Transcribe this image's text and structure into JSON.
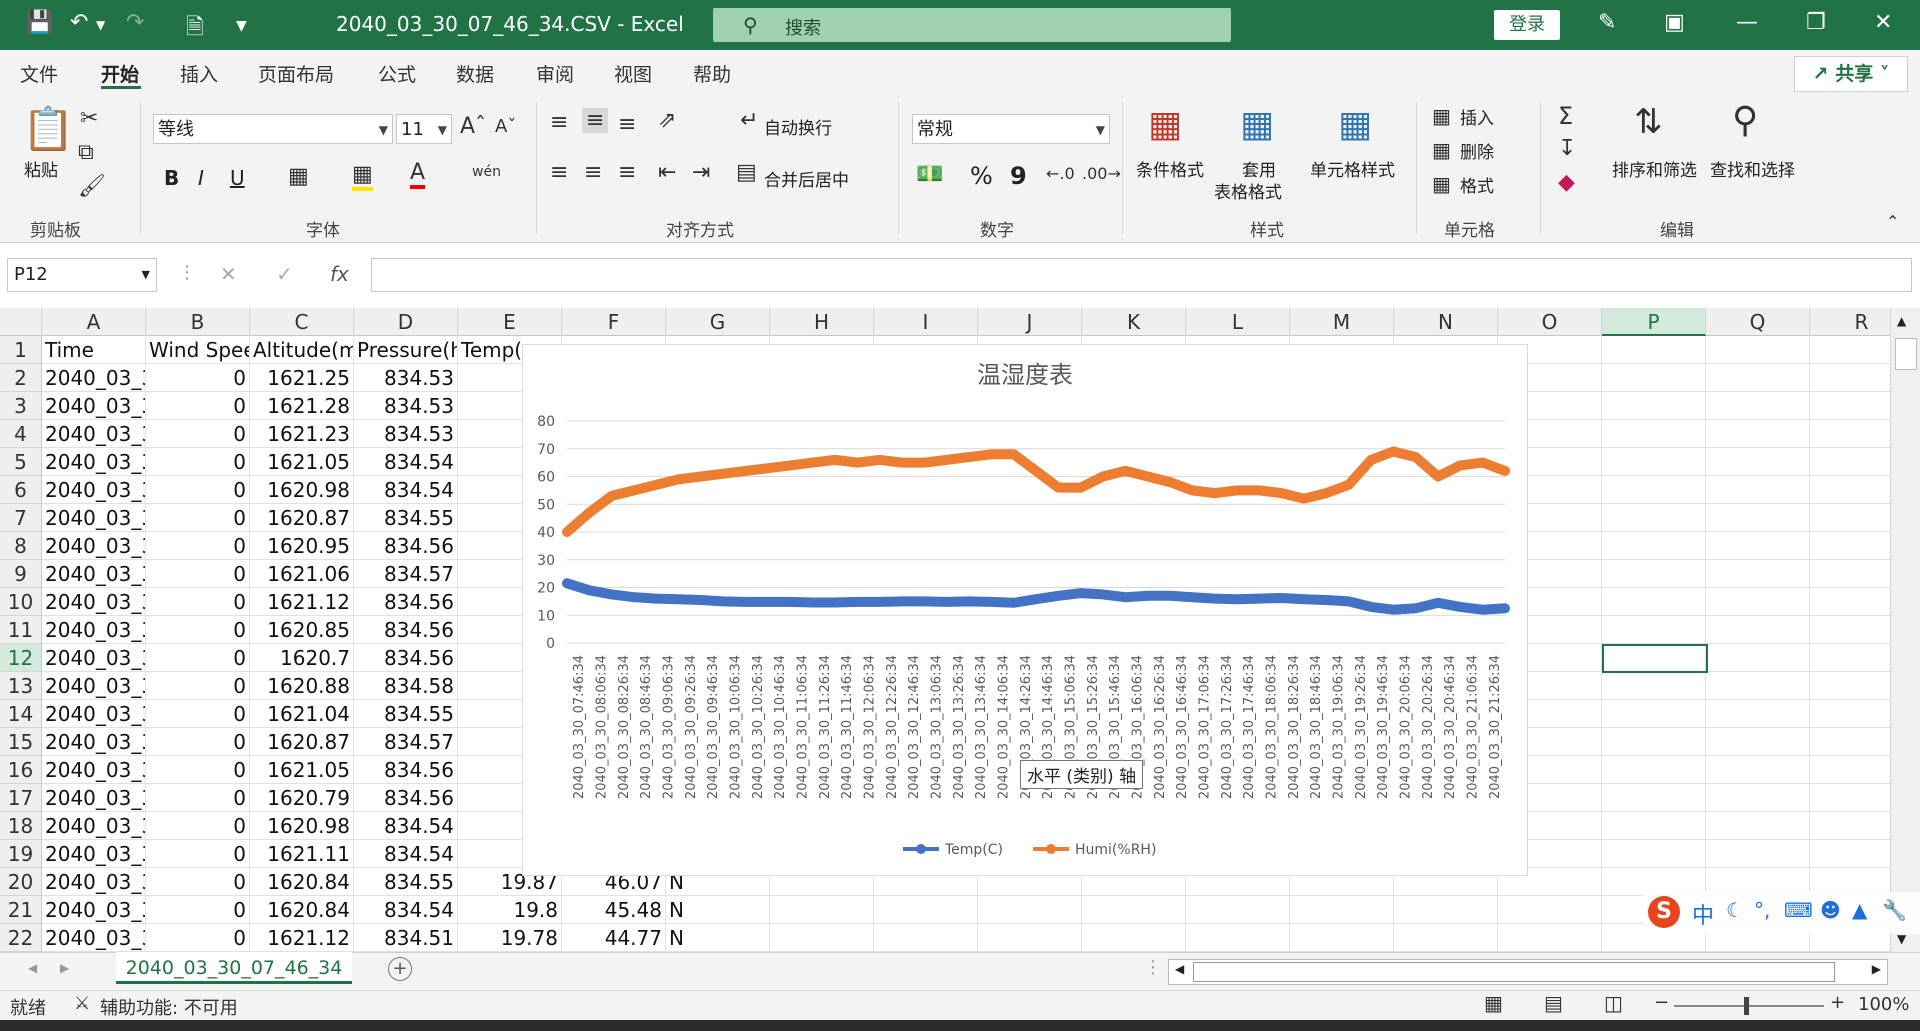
{
  "titlebar": {
    "document_title": "2040_03_30_07_46_34.CSV  -  Excel",
    "search_placeholder": "搜索",
    "login_label": "登录",
    "bg_color": "#217346"
  },
  "menu": {
    "tabs": [
      "文件",
      "开始",
      "插入",
      "页面布局",
      "公式",
      "数据",
      "审阅",
      "视图",
      "帮助"
    ],
    "active_tab": "开始",
    "share_label": "共享"
  },
  "ribbon": {
    "clipboard": {
      "paste_label": "粘贴",
      "group_label": "剪贴板"
    },
    "font": {
      "font_name": "等线",
      "font_size": "11",
      "group_label": "字体",
      "bold": "B",
      "italic": "I",
      "underline": "U"
    },
    "alignment": {
      "wrap_label": "自动换行",
      "merge_label": "合并后居中",
      "group_label": "对齐方式"
    },
    "number": {
      "format": "常规",
      "percent": "%",
      "comma": "9",
      "group_label": "数字"
    },
    "styles": {
      "conditional_label": "条件格式",
      "table_label_1": "套用",
      "table_label_2": "表格格式",
      "cell_style_label": "单元格样式",
      "group_label": "样式"
    },
    "cells": {
      "insert_label": "插入",
      "delete_label": "删除",
      "format_label": "格式",
      "group_label": "单元格"
    },
    "editing": {
      "sort_label": "排序和筛选",
      "find_label": "查找和选择",
      "group_label": "编辑"
    }
  },
  "formula_bar": {
    "name_box": "P12",
    "fx": "fx",
    "cancel": "✕",
    "confirm": "✓"
  },
  "grid": {
    "columns": [
      "A",
      "B",
      "C",
      "D",
      "E",
      "F",
      "G",
      "H",
      "I",
      "J",
      "K",
      "L",
      "M",
      "N",
      "O",
      "P",
      "Q",
      "R"
    ],
    "selected_column": "P",
    "selected_row": "12",
    "rows": [
      {
        "n": "1",
        "a": "Time",
        "b": "Wind Spee",
        "c": "Altitude(m",
        "d": "Pressure(hI",
        "e": "Temp(",
        "f": "",
        "g": ""
      },
      {
        "n": "2",
        "a": "2040_03_3",
        "b": "0",
        "c": "1621.25",
        "d": "834.53",
        "e": "2",
        "f": "",
        "g": ""
      },
      {
        "n": "3",
        "a": "2040_03_3",
        "b": "0",
        "c": "1621.28",
        "d": "834.53",
        "e": "2",
        "f": "",
        "g": ""
      },
      {
        "n": "4",
        "a": "2040_03_3",
        "b": "0",
        "c": "1621.23",
        "d": "834.53",
        "e": "2",
        "f": "",
        "g": ""
      },
      {
        "n": "5",
        "a": "2040_03_3",
        "b": "0",
        "c": "1621.05",
        "d": "834.54",
        "e": "2",
        "f": "",
        "g": ""
      },
      {
        "n": "6",
        "a": "2040_03_3",
        "b": "0",
        "c": "1620.98",
        "d": "834.54",
        "e": "2",
        "f": "",
        "g": ""
      },
      {
        "n": "7",
        "a": "2040_03_3",
        "b": "0",
        "c": "1620.87",
        "d": "834.55",
        "e": "2",
        "f": "",
        "g": ""
      },
      {
        "n": "8",
        "a": "2040_03_3",
        "b": "0",
        "c": "1620.95",
        "d": "834.56",
        "e": "2",
        "f": "",
        "g": ""
      },
      {
        "n": "9",
        "a": "2040_03_3",
        "b": "0",
        "c": "1621.06",
        "d": "834.57",
        "e": "2",
        "f": "",
        "g": ""
      },
      {
        "n": "10",
        "a": "2040_03_3",
        "b": "0",
        "c": "1621.12",
        "d": "834.56",
        "e": "2",
        "f": "",
        "g": ""
      },
      {
        "n": "11",
        "a": "2040_03_3",
        "b": "0",
        "c": "1620.85",
        "d": "834.56",
        "e": "2",
        "f": "",
        "g": ""
      },
      {
        "n": "12",
        "a": "2040_03_3",
        "b": "0",
        "c": "1620.7",
        "d": "834.56",
        "e": "",
        "f": "",
        "g": ""
      },
      {
        "n": "13",
        "a": "2040_03_3",
        "b": "0",
        "c": "1620.88",
        "d": "834.58",
        "e": "",
        "f": "",
        "g": ""
      },
      {
        "n": "14",
        "a": "2040_03_3",
        "b": "0",
        "c": "1621.04",
        "d": "834.55",
        "e": "2",
        "f": "",
        "g": ""
      },
      {
        "n": "15",
        "a": "2040_03_3",
        "b": "0",
        "c": "1620.87",
        "d": "834.57",
        "e": "2",
        "f": "",
        "g": ""
      },
      {
        "n": "16",
        "a": "2040_03_3",
        "b": "0",
        "c": "1621.05",
        "d": "834.56",
        "e": "2",
        "f": "",
        "g": ""
      },
      {
        "n": "17",
        "a": "2040_03_3",
        "b": "0",
        "c": "1620.79",
        "d": "834.56",
        "e": "1",
        "f": "",
        "g": ""
      },
      {
        "n": "18",
        "a": "2040_03_3",
        "b": "0",
        "c": "1620.98",
        "d": "834.54",
        "e": "1",
        "f": "",
        "g": ""
      },
      {
        "n": "19",
        "a": "2040_03_3",
        "b": "0",
        "c": "1621.11",
        "d": "834.54",
        "e": "1",
        "f": "",
        "g": ""
      },
      {
        "n": "20",
        "a": "2040_03_3",
        "b": "0",
        "c": "1620.84",
        "d": "834.55",
        "e": "19.87",
        "f": "46.07",
        "g": "N"
      },
      {
        "n": "21",
        "a": "2040_03_3",
        "b": "0",
        "c": "1620.84",
        "d": "834.54",
        "e": "19.8",
        "f": "45.48",
        "g": "N"
      },
      {
        "n": "22",
        "a": "2040_03_3",
        "b": "0",
        "c": "1621.12",
        "d": "834.51",
        "e": "19.78",
        "f": "44.77",
        "g": "N"
      }
    ]
  },
  "chart_data": {
    "type": "line",
    "title": "温湿度表",
    "ylim": [
      0,
      80
    ],
    "yticks": [
      0,
      10,
      20,
      30,
      40,
      50,
      60,
      70,
      80
    ],
    "x_tick_labels": [
      "2040_03_30_07:46:34",
      "2040_03_30_08:06:34",
      "2040_03_30_08:26:34",
      "2040_03_30_08:46:34",
      "2040_03_30_09:06:34",
      "2040_03_30_09:26:34",
      "2040_03_30_09:46:34",
      "2040_03_30_10:06:34",
      "2040_03_30_10:26:34",
      "2040_03_30_10:46:34",
      "2040_03_30_11:06:34",
      "2040_03_30_11:26:34",
      "2040_03_30_11:46:34",
      "2040_03_30_12:06:34",
      "2040_03_30_12:26:34",
      "2040_03_30_12:46:34",
      "2040_03_30_13:06:34",
      "2040_03_30_13:26:34",
      "2040_03_30_13:46:34",
      "2040_03_30_14:06:34",
      "2040_03_30_14:26:34",
      "2040_03_30_14:46:34",
      "2040_03_30_15:06:34",
      "2040_03_30_15:26:34",
      "2040_03_30_15:46:34",
      "2040_03_30_16:06:34",
      "2040_03_30_16:26:34",
      "2040_03_30_16:46:34",
      "2040_03_30_17:06:34",
      "2040_03_30_17:26:34",
      "2040_03_30_17:46:34",
      "2040_03_30_18:06:34",
      "2040_03_30_18:26:34",
      "2040_03_30_18:46:34",
      "2040_03_30_19:06:34",
      "2040_03_30_19:26:34",
      "2040_03_30_19:46:34",
      "2040_03_30_20:06:34",
      "2040_03_30_20:26:34",
      "2040_03_30_20:46:34",
      "2040_03_30_21:06:34",
      "2040_03_30_21:26:34"
    ],
    "series": [
      {
        "name": "Temp(C)",
        "color": "#4472C4",
        "values": [
          21.5,
          19,
          17.5,
          16.5,
          16,
          15.8,
          15.5,
          15,
          14.8,
          14.8,
          14.8,
          14.6,
          14.6,
          14.8,
          14.8,
          15,
          15,
          14.8,
          15,
          14.8,
          14.5,
          15.8,
          17,
          18,
          17.5,
          16.5,
          17,
          17,
          16.5,
          16,
          15.8,
          16,
          16.2,
          15.8,
          15.5,
          15,
          13,
          12,
          12.5,
          14.5,
          13,
          12,
          12.5
        ]
      },
      {
        "name": "Humi(%RH)",
        "color": "#ED7D31",
        "values": [
          40,
          47,
          53,
          55,
          57,
          59,
          60,
          61,
          62,
          63,
          64,
          65,
          66,
          65,
          66,
          65,
          65,
          66,
          67,
          68,
          68,
          62,
          56,
          56,
          60,
          62,
          60,
          58,
          55,
          54,
          55,
          55,
          54,
          52,
          54,
          57,
          66,
          69,
          67,
          60,
          64,
          65,
          62
        ]
      }
    ],
    "legend_position": "bottom",
    "axis_tooltip": "水平 (类别) 轴"
  },
  "sheets": {
    "active": "2040_03_30_07_46_34",
    "add_label": "+"
  },
  "status": {
    "ready": "就绪",
    "accessibility": "辅助功能: 不可用",
    "zoom": "100%"
  },
  "ime": {
    "label": "中"
  }
}
